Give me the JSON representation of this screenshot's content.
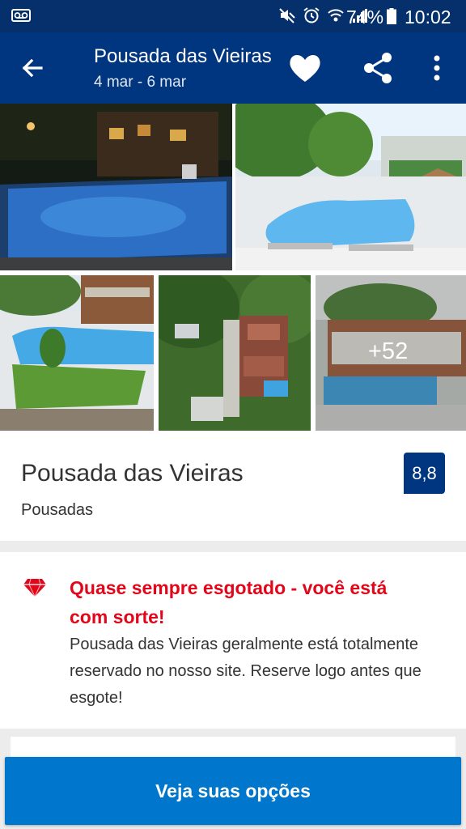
{
  "status_bar": {
    "battery_percent": "74%",
    "time": "10:02",
    "icons": [
      "voicemail-icon",
      "mute-icon",
      "alarm-icon",
      "wifi-icon",
      "signal-icon",
      "battery-icon"
    ]
  },
  "header": {
    "title": "Pousada das Vieiras",
    "dates": "4 mar - 6 mar",
    "icons": [
      "back-arrow-icon",
      "heart-icon",
      "share-icon",
      "more-vert-icon"
    ]
  },
  "gallery": {
    "more_count": "+52",
    "photos": [
      "pool-night",
      "pool-day",
      "pool-garden",
      "aerial-view",
      "pool-building"
    ]
  },
  "hotel": {
    "name": "Pousada das Vieiras",
    "type": "Pousadas",
    "score": "8,8"
  },
  "scarcity": {
    "headline": "Quase sempre esgotado - você está com sorte!",
    "body": "Pousada das Vieiras geralmente está totalmente reservado no nosso site. Reserve logo antes que esgote!",
    "accent_color": "#e1061a"
  },
  "cta": {
    "label": "Veja suas opções"
  },
  "colors": {
    "brand_dark": "#003580",
    "status_bar": "#05306b",
    "button_blue": "#0077cc"
  }
}
